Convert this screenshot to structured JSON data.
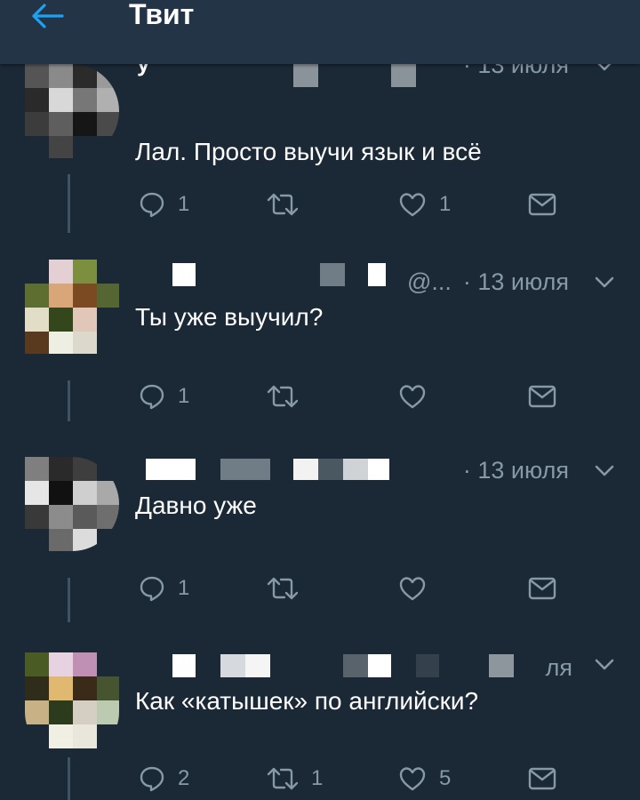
{
  "header": {
    "title": "Твит",
    "back_icon": "arrow-left-icon",
    "accent": "#1da1f2"
  },
  "tweets": [
    {
      "name_partial": "у",
      "handle": "",
      "date": "· 13 июля",
      "text": "Лал. Просто выучи язык и всё",
      "reply_count": "1",
      "retweet_count": "",
      "like_count": "1"
    },
    {
      "name_partial": "",
      "handle": "@...",
      "date": "· 13 июля",
      "text": "Ты уже выучил?",
      "reply_count": "1",
      "retweet_count": "",
      "like_count": ""
    },
    {
      "name_partial": "",
      "handle": "",
      "date": "· 13 июля",
      "text": "Давно уже",
      "reply_count": "1",
      "retweet_count": "",
      "like_count": ""
    },
    {
      "name_partial": "",
      "handle": "",
      "date": "ля",
      "text": "Как «катышек» по английски?",
      "reply_count": "2",
      "retweet_count": "1",
      "like_count": "5"
    }
  ]
}
